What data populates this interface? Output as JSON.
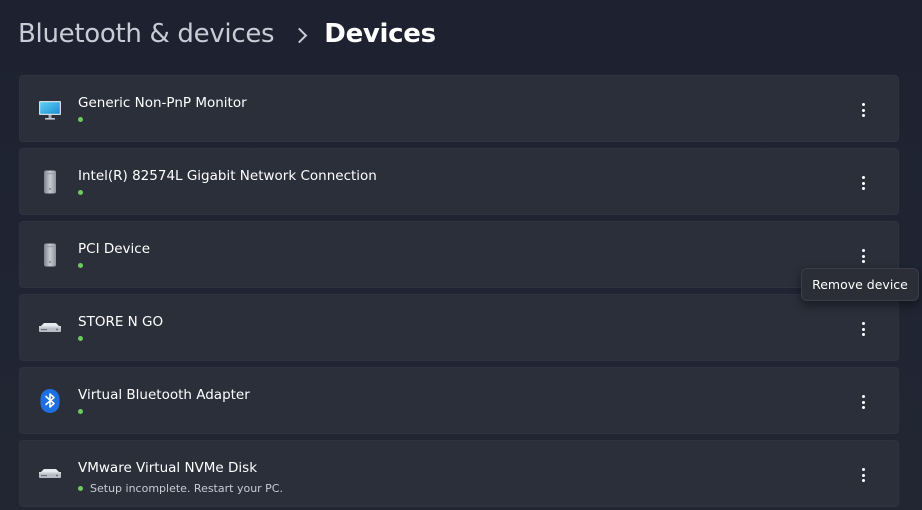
{
  "breadcrumb": {
    "parent": "Bluetooth & devices",
    "current": "Devices"
  },
  "devices": [
    {
      "name": "Generic Non-PnP Monitor",
      "icon": "monitor-icon",
      "status": ""
    },
    {
      "name": "Intel(R) 82574L Gigabit Network Connection",
      "icon": "device-tower-icon",
      "status": ""
    },
    {
      "name": "PCI Device",
      "icon": "device-tower-icon",
      "status": ""
    },
    {
      "name": "STORE N GO",
      "icon": "drive-icon",
      "status": ""
    },
    {
      "name": "Virtual Bluetooth Adapter",
      "icon": "bluetooth-icon",
      "status": ""
    },
    {
      "name": "VMware Virtual NVMe Disk",
      "icon": "drive-icon",
      "status": "Setup incomplete. Restart your PC."
    }
  ],
  "tooltip": {
    "text": "Remove device"
  },
  "colors": {
    "status_ok": "#6ccb5f",
    "card_bg": "#2b2f3a",
    "bluetooth_blue": "#1f6fe0"
  }
}
